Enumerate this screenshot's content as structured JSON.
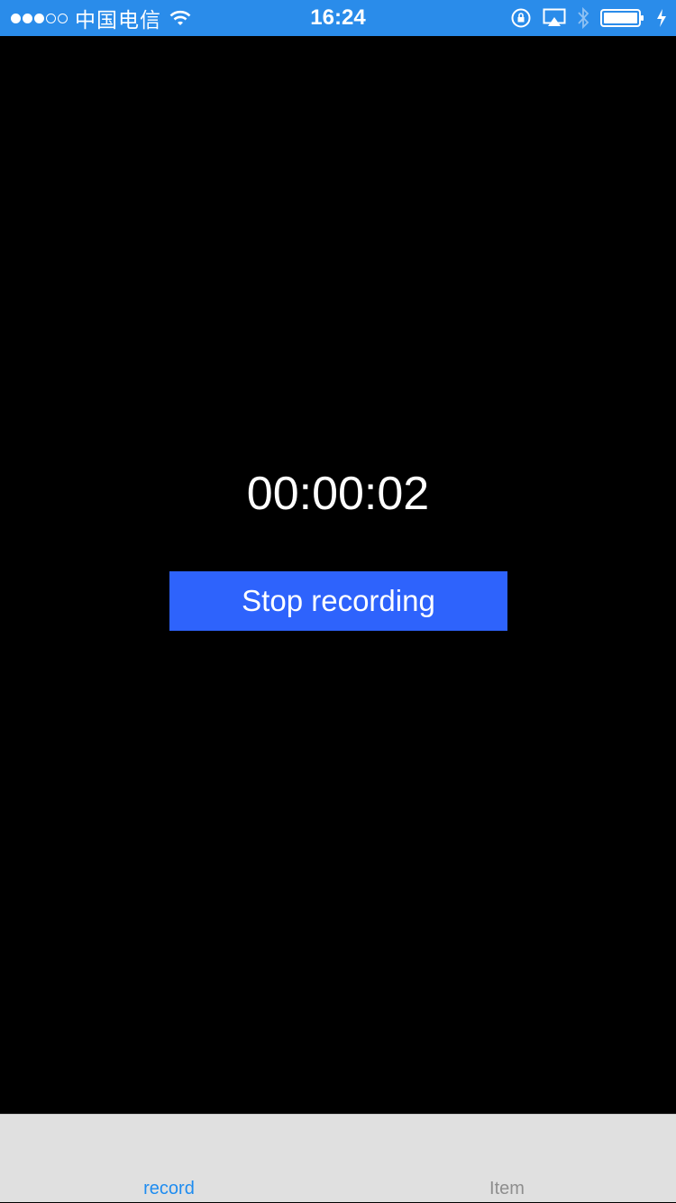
{
  "status_bar": {
    "carrier": "中国电信",
    "time": "16:24",
    "signal_strength": 3,
    "signal_max": 5,
    "icons": [
      "wifi-icon",
      "rotation-lock-icon",
      "airplay-icon",
      "bluetooth-icon",
      "battery-icon",
      "charging-icon"
    ],
    "background": "#2a8cea"
  },
  "recorder": {
    "elapsed_time": "00:00:02",
    "stop_button_label": "Stop recording",
    "stop_button_color": "#2e63fc"
  },
  "tab_bar": {
    "tabs": [
      {
        "label": "record",
        "selected": true,
        "color": "#1e8cf0"
      },
      {
        "label": "Item",
        "selected": false,
        "color": "#8e8e8e"
      }
    ]
  }
}
